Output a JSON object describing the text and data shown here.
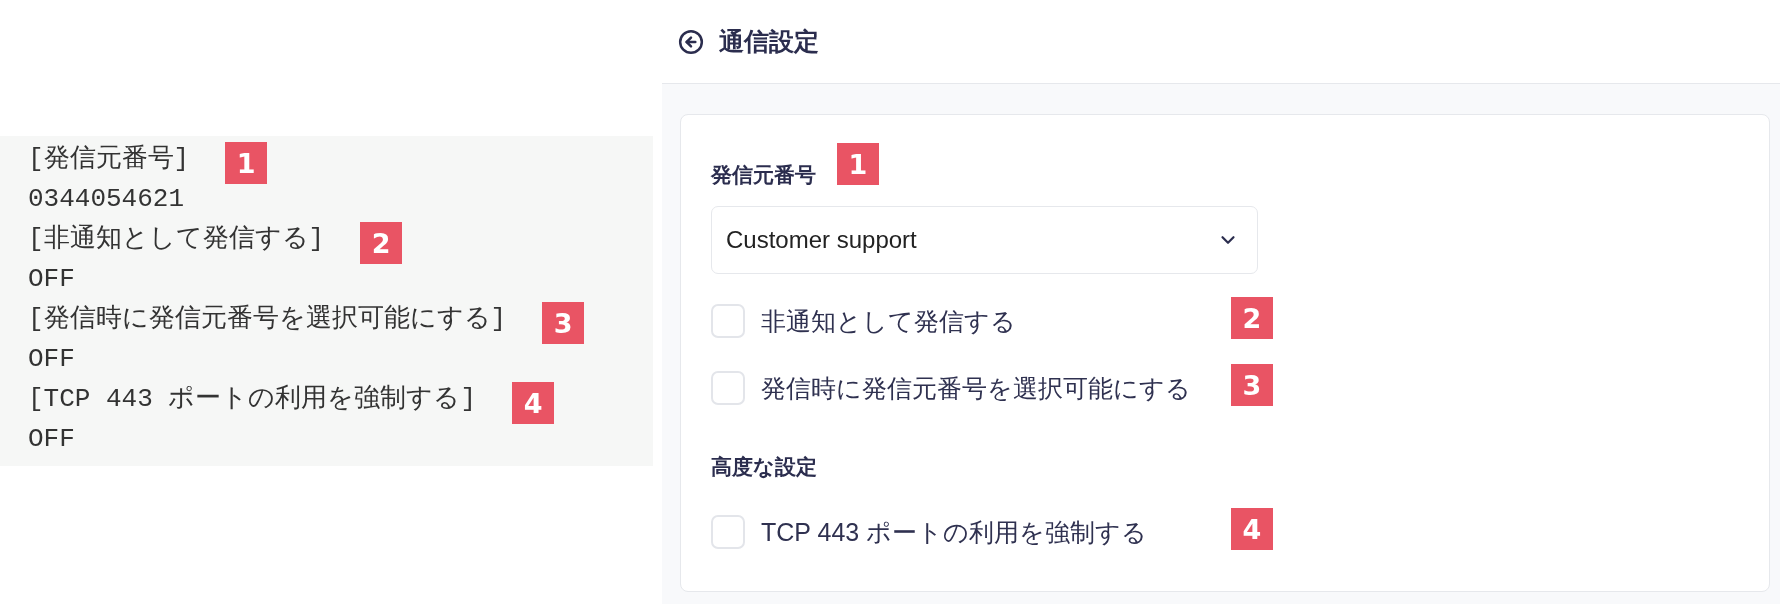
{
  "code_block": {
    "lines": [
      {
        "text": "[発信元番号]",
        "badge": "1"
      },
      {
        "text": "0344054621"
      },
      {
        "text": "[非通知として発信する]",
        "badge": "2"
      },
      {
        "text": "OFF"
      },
      {
        "text": "[発信時に発信元番号を選択可能にする]",
        "badge": "3"
      },
      {
        "text": "OFF"
      },
      {
        "text": "[TCP 443 ポートの利用を強制する]",
        "badge": "4"
      },
      {
        "text": "OFF"
      }
    ]
  },
  "header": {
    "title": "通信設定"
  },
  "form": {
    "caller_number": {
      "label": "発信元番号",
      "badge": "1",
      "select": {
        "value": "Customer support"
      }
    },
    "options": [
      {
        "label": "非通知として発信する",
        "checked": false,
        "badge": "2"
      },
      {
        "label": "発信時に発信元番号を選択可能にする",
        "checked": false,
        "badge": "3"
      }
    ],
    "advanced": {
      "heading": "高度な設定",
      "options": [
        {
          "label": "TCP 443 ポートの利用を強制する",
          "checked": false,
          "badge": "4"
        }
      ]
    }
  }
}
